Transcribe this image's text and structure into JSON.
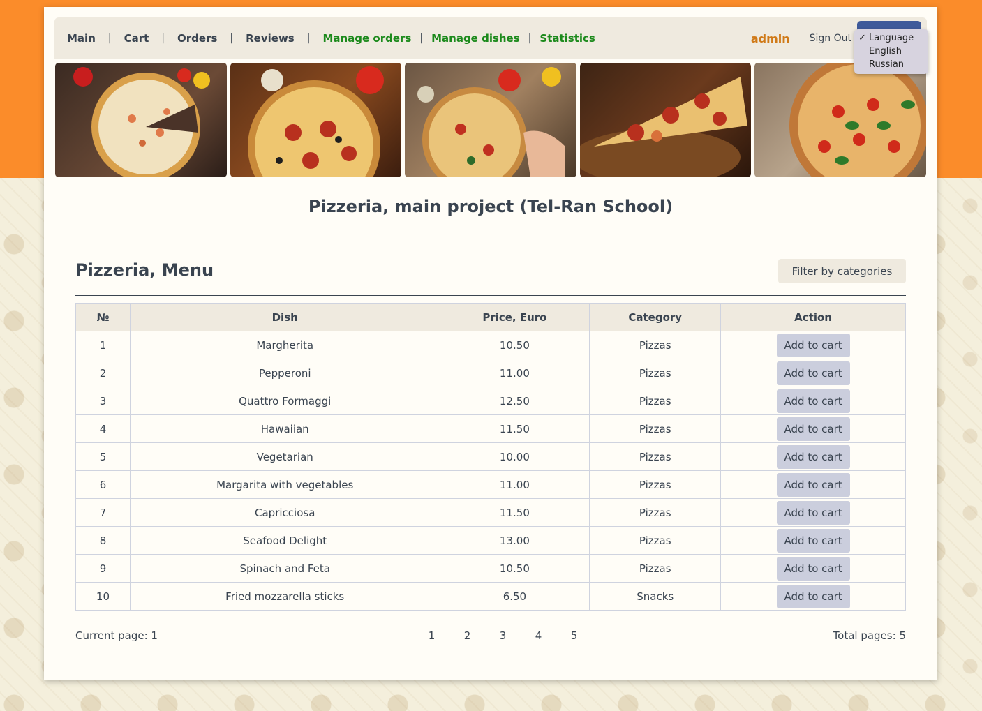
{
  "nav": {
    "links": [
      {
        "label": "Main"
      },
      {
        "label": "Cart"
      },
      {
        "label": "Orders"
      },
      {
        "label": "Reviews"
      }
    ],
    "admin_links": [
      {
        "label": "Manage orders"
      },
      {
        "label": "Manage dishes"
      },
      {
        "label": "Statistics"
      }
    ],
    "user": "admin",
    "sign_out": "Sign Out",
    "language": {
      "options": [
        "Language",
        "English",
        "Russian"
      ],
      "selected": "Language"
    },
    "colors": {
      "admin_link": "#1c8a1c",
      "user": "#d07a18",
      "background": "#fb8c2a"
    }
  },
  "project_title": "Pizzeria, main project (Tel-Ran School)",
  "menu": {
    "title": "Pizzeria, Menu",
    "filter_button": "Filter by categories",
    "columns": [
      "№",
      "Dish",
      "Price, Euro",
      "Category",
      "Action"
    ],
    "rows": [
      {
        "num": "1",
        "dish": "Margherita",
        "price": "10.50",
        "category": "Pizzas",
        "action": "Add to cart"
      },
      {
        "num": "2",
        "dish": "Pepperoni",
        "price": "11.00",
        "category": "Pizzas",
        "action": "Add to cart"
      },
      {
        "num": "3",
        "dish": "Quattro Formaggi",
        "price": "12.50",
        "category": "Pizzas",
        "action": "Add to cart"
      },
      {
        "num": "4",
        "dish": "Hawaiian",
        "price": "11.50",
        "category": "Pizzas",
        "action": "Add to cart"
      },
      {
        "num": "5",
        "dish": "Vegetarian",
        "price": "10.00",
        "category": "Pizzas",
        "action": "Add to cart"
      },
      {
        "num": "6",
        "dish": "Margarita with vegetables",
        "price": "11.00",
        "category": "Pizzas",
        "action": "Add to cart"
      },
      {
        "num": "7",
        "dish": "Capricciosa",
        "price": "11.50",
        "category": "Pizzas",
        "action": "Add to cart"
      },
      {
        "num": "8",
        "dish": "Seafood Delight",
        "price": "13.00",
        "category": "Pizzas",
        "action": "Add to cart"
      },
      {
        "num": "9",
        "dish": "Spinach and Feta",
        "price": "10.50",
        "category": "Pizzas",
        "action": "Add to cart"
      },
      {
        "num": "10",
        "dish": "Fried mozzarella sticks",
        "price": "6.50",
        "category": "Snacks",
        "action": "Add to cart"
      }
    ]
  },
  "pagination": {
    "current_label": "Current page: 1",
    "pages": [
      "1",
      "2",
      "3",
      "4",
      "5"
    ],
    "total_label": "Total pages: 5"
  }
}
